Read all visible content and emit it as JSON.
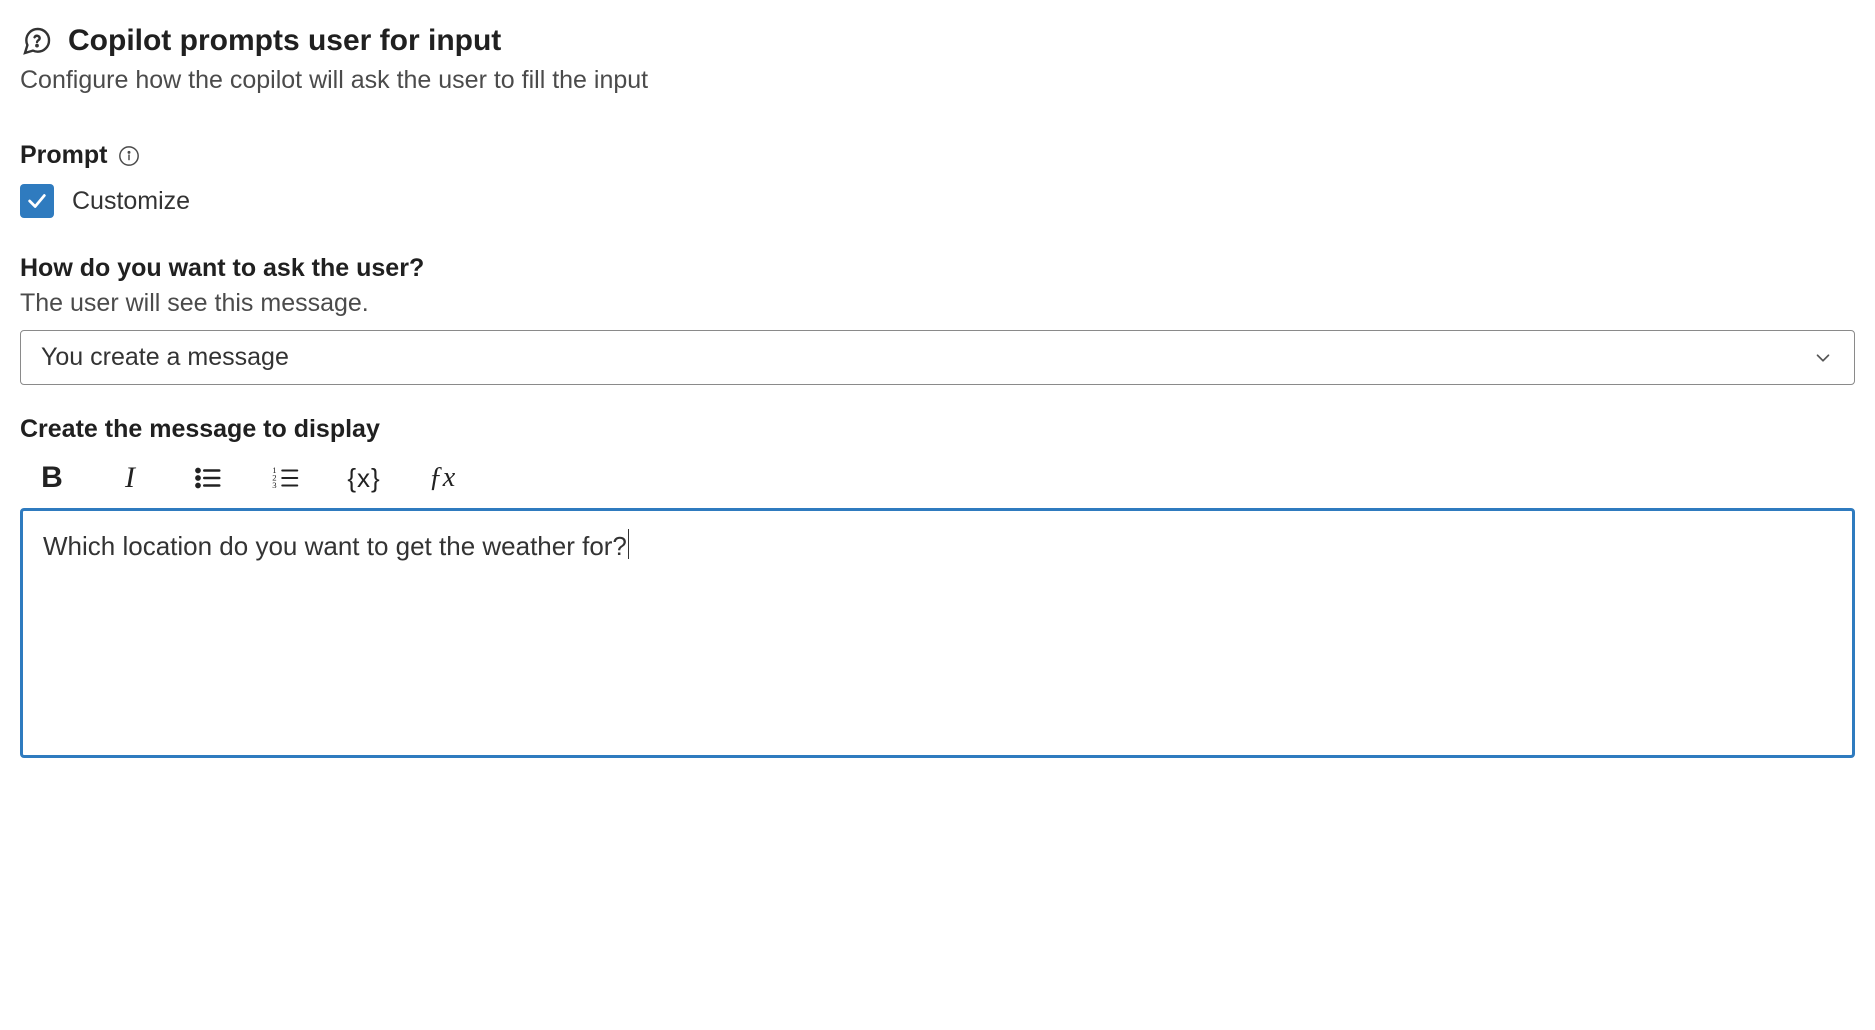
{
  "header": {
    "title": "Copilot prompts user for input",
    "subtitle": "Configure how the copilot will ask the user to fill the input"
  },
  "prompt_section": {
    "label": "Prompt",
    "customize_checkbox": {
      "label": "Customize",
      "checked": true
    }
  },
  "ask_section": {
    "heading": "How do you want to ask the user?",
    "sub": "The user will see this message.",
    "dropdown_value": "You create a message"
  },
  "editor_section": {
    "heading": "Create the message to display",
    "toolbar": {
      "bold": "B",
      "italic": "I",
      "bullet_list": "bullet-list-icon",
      "numbered_list": "numbered-list-icon",
      "variable": "{x}",
      "formula": "ƒx"
    },
    "content": "Which location do you want to get the weather for?"
  }
}
